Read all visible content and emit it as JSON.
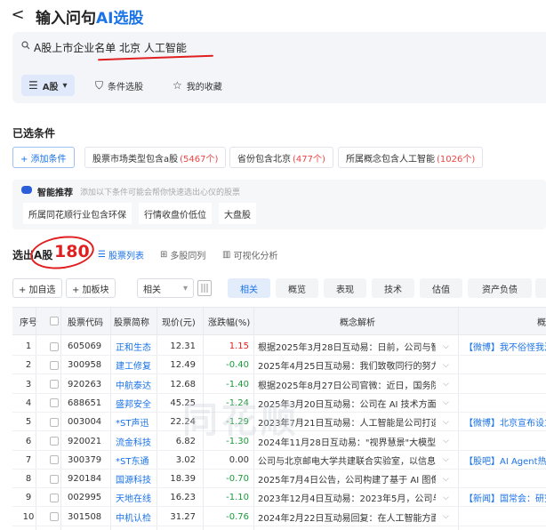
{
  "header": {
    "back": "<",
    "title_prefix": "输入问句",
    "title_ai": "AI选股"
  },
  "search": {
    "query": "A股上市企业名单 北京  人工智能",
    "tools": [
      {
        "label": "A股",
        "icon": "☰",
        "arrow": "▾",
        "active": true
      },
      {
        "label": "条件选股",
        "icon": "⛉",
        "active": false
      },
      {
        "label": "我的收藏",
        "icon": "☆",
        "active": false
      }
    ]
  },
  "conditions": {
    "title": "已选条件",
    "add_label": "+ 添加条件",
    "chips": [
      {
        "text": "股票市场类型包含a股",
        "count": "(5467个)"
      },
      {
        "text": "省份包含北京",
        "count": "(477个)"
      },
      {
        "text": "所属概念包含人工智能",
        "count": "(1026个)"
      }
    ]
  },
  "recommend": {
    "title": "智能推荐",
    "subtitle": "添加以下条件可能会帮你快速选出心仪的股票",
    "chips": [
      "所属同花顺行业包含环保",
      "行情收盘价低位",
      "大盘股"
    ]
  },
  "results": {
    "label": "选出A股",
    "count": "180",
    "views": [
      {
        "label": "股票列表",
        "icon": "☰",
        "active": true
      },
      {
        "label": "多股同列",
        "icon": "⊞",
        "active": false
      },
      {
        "label": "可视化分析",
        "icon": "▥",
        "active": false
      }
    ]
  },
  "toolbar": {
    "add_watch": "+ 加自选",
    "add_block": "+ 加板块",
    "sort_value": "相关",
    "sort_arrow": "▾",
    "tabs": [
      "相关",
      "概览",
      "表现",
      "技术",
      "估值",
      "资产负债"
    ]
  },
  "table": {
    "headers": [
      "序号",
      "股票代码",
      "股票简称",
      "现价(元)",
      "涨跌幅(%)",
      "概念解析",
      "概"
    ],
    "rows": [
      {
        "idx": "1",
        "code": "605069",
        "name": "正和生态",
        "price": "12.31",
        "change": "1.15",
        "dir": "up",
        "concept": "根据2025年3月28日互动易：日前，公司与智...",
        "news": "【微博】我不俗怪我混"
      },
      {
        "idx": "2",
        "code": "300958",
        "name": "建工修复",
        "price": "12.49",
        "change": "-0.40",
        "dir": "down",
        "concept": "2025年4月25日互动易：我们致敬同行的努力...",
        "news": ""
      },
      {
        "idx": "3",
        "code": "920263",
        "name": "中航泰达",
        "price": "12.68",
        "change": "-1.40",
        "dir": "down",
        "concept": "根据2025年8月27日公司官微：近日，国务院...",
        "news": ""
      },
      {
        "idx": "4",
        "code": "688651",
        "name": "盛邦安全",
        "price": "45.25",
        "change": "-1.24",
        "dir": "down",
        "concept": "2025年3月20日互动易：公司在 AI 技术方面有...",
        "news": ""
      },
      {
        "idx": "5",
        "code": "003004",
        "name": "*ST声迅",
        "price": "22.24",
        "change": "-1.29",
        "dir": "down",
        "concept": "2023年7月21日互动易：人工智能是公司打造...",
        "news": "【微博】北京宣布设立"
      },
      {
        "idx": "6",
        "code": "920021",
        "name": "流金科技",
        "price": "6.82",
        "change": "-1.30",
        "dir": "down",
        "concept": "2024年11月28日互动易：\"视界慧景\"大模型...",
        "news": ""
      },
      {
        "idx": "7",
        "code": "300379",
        "name": "*ST东通",
        "price": "3.02",
        "change": "0.00",
        "dir": "flat",
        "concept": "公司与北京邮电大学共建联合实验室，以信息...",
        "news": "【股吧】AI Agent热点"
      },
      {
        "idx": "8",
        "code": "920184",
        "name": "国源科技",
        "price": "18.39",
        "change": "-0.70",
        "dir": "down",
        "concept": "2025年7月4日公告，公司构建了基于 AI 图像...",
        "news": ""
      },
      {
        "idx": "9",
        "code": "002995",
        "name": "天地在线",
        "price": "16.23",
        "change": "-1.10",
        "dir": "down",
        "concept": "2023年12月4日互动易：2023年5月，公司与...",
        "news": "【新闻】国常会：研究"
      },
      {
        "idx": "10",
        "code": "301508",
        "name": "中机认检",
        "price": "31.27",
        "change": "-0.76",
        "dir": "down",
        "concept": "2024年2月22日互动易回复：在人工智能方面...",
        "news": ""
      }
    ]
  },
  "watermark": "同花顺",
  "colors": {
    "accent": "#1a73e8",
    "up": "#e02020",
    "down": "#1a9a3a",
    "annotation": "#e02020"
  }
}
